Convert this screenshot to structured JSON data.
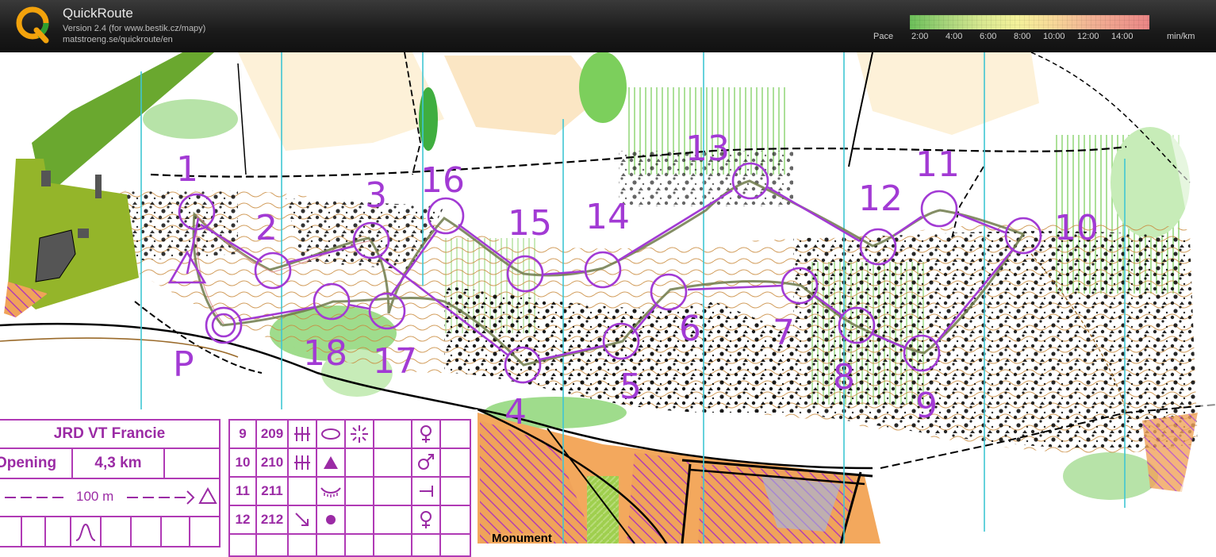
{
  "header": {
    "app_title": "QuickRoute",
    "version_line": "Version 2.4  (for www.bestik.cz/mapy)",
    "url_line": "matstroeng.se/quickroute/en",
    "pace_label": "Pace",
    "pace_ticks": [
      "2:00",
      "4:00",
      "6:00",
      "8:00",
      "10:00",
      "12:00",
      "14:00"
    ],
    "pace_unit": "min/km"
  },
  "course": {
    "controls": [
      "1",
      "2",
      "3",
      "4",
      "5",
      "6",
      "7",
      "8",
      "9",
      "10",
      "11",
      "12",
      "13",
      "14",
      "15",
      "16",
      "17",
      "18"
    ],
    "start_label": "P",
    "area_label": "Monument"
  },
  "legend": {
    "event": "JRD VT Francie",
    "class": "Opening",
    "length": "4,3 km",
    "finish_text": "100 m",
    "rows": [
      {
        "num": "9",
        "code": "209"
      },
      {
        "num": "10",
        "code": "210"
      },
      {
        "num": "11",
        "code": "211"
      },
      {
        "num": "12",
        "code": "212"
      }
    ]
  },
  "colors": {
    "course_purple": "#a23ad4",
    "route": "#7a7a5a",
    "legend_purple": "#b03ab5"
  }
}
